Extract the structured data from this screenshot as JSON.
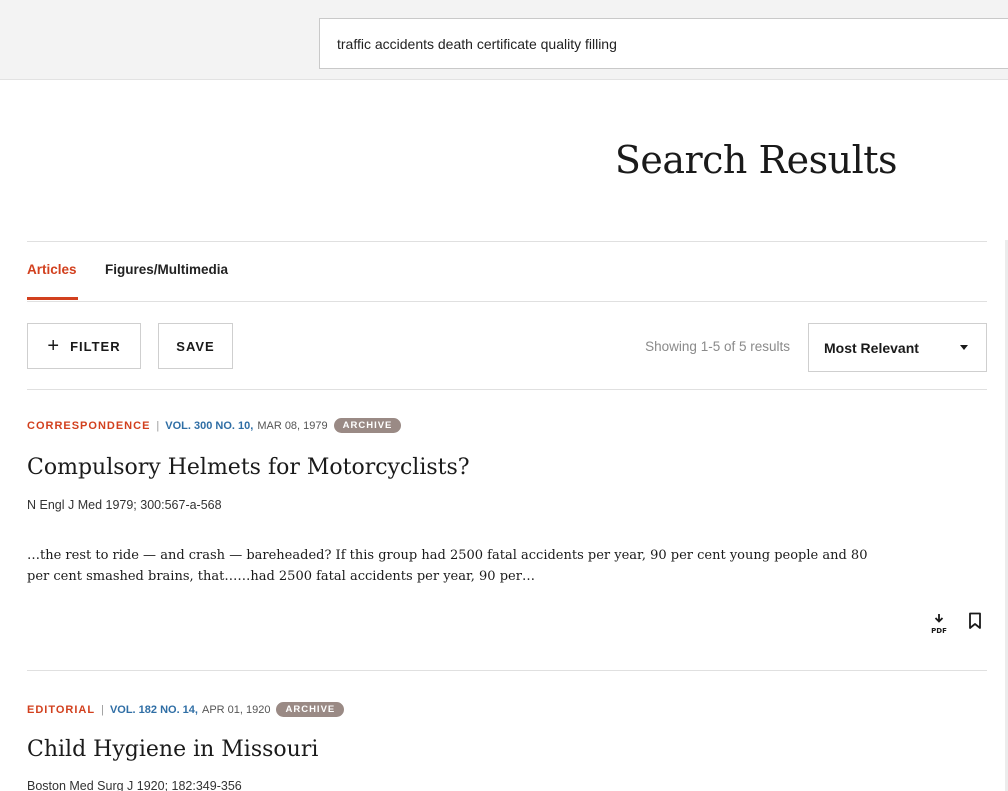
{
  "search": {
    "query": "traffic accidents death certificate quality filling"
  },
  "page": {
    "title": "Search Results"
  },
  "tabs": [
    {
      "label": "Articles",
      "active": true
    },
    {
      "label": "Figures/Multimedia",
      "active": false
    }
  ],
  "toolbar": {
    "filter_icon": "+",
    "filter_label": "FILTER",
    "save_label": "SAVE",
    "showing": "Showing 1-5 of 5 results",
    "sort_selected": "Most Relevant"
  },
  "results": [
    {
      "type": "CORRESPONDENCE",
      "separator": "|",
      "volume": "VOL. 300 NO. 10,",
      "date": "MAR 08, 1979",
      "badge": "ARCHIVE",
      "title": "Compulsory Helmets for Motorcyclists?",
      "citation": "N Engl J Med 1979; 300:567-a-568",
      "snippet_line1": "…the rest to ride — and crash — bareheaded? If this group had 2500 fatal accidents per year, 90 per cent young people and 80",
      "snippet_line2": "per cent smashed brains, that……had 2500 fatal accidents per year, 90 per…",
      "pdf_label": "PDF"
    },
    {
      "type": "EDITORIAL",
      "separator": "|",
      "volume": "VOL. 182 NO. 14,",
      "date": "APR 01, 1920",
      "badge": "ARCHIVE",
      "title": "Child Hygiene in Missouri",
      "citation": "Boston Med Surg J 1920; 182:349-356"
    }
  ],
  "colors": {
    "accent": "#d2401e",
    "link": "#2f6ea5",
    "badge": "#9a8a85"
  },
  "icons": {
    "pdf": "pdf-download-icon",
    "bookmark": "bookmark-icon",
    "dropdown": "caret-down-icon"
  }
}
